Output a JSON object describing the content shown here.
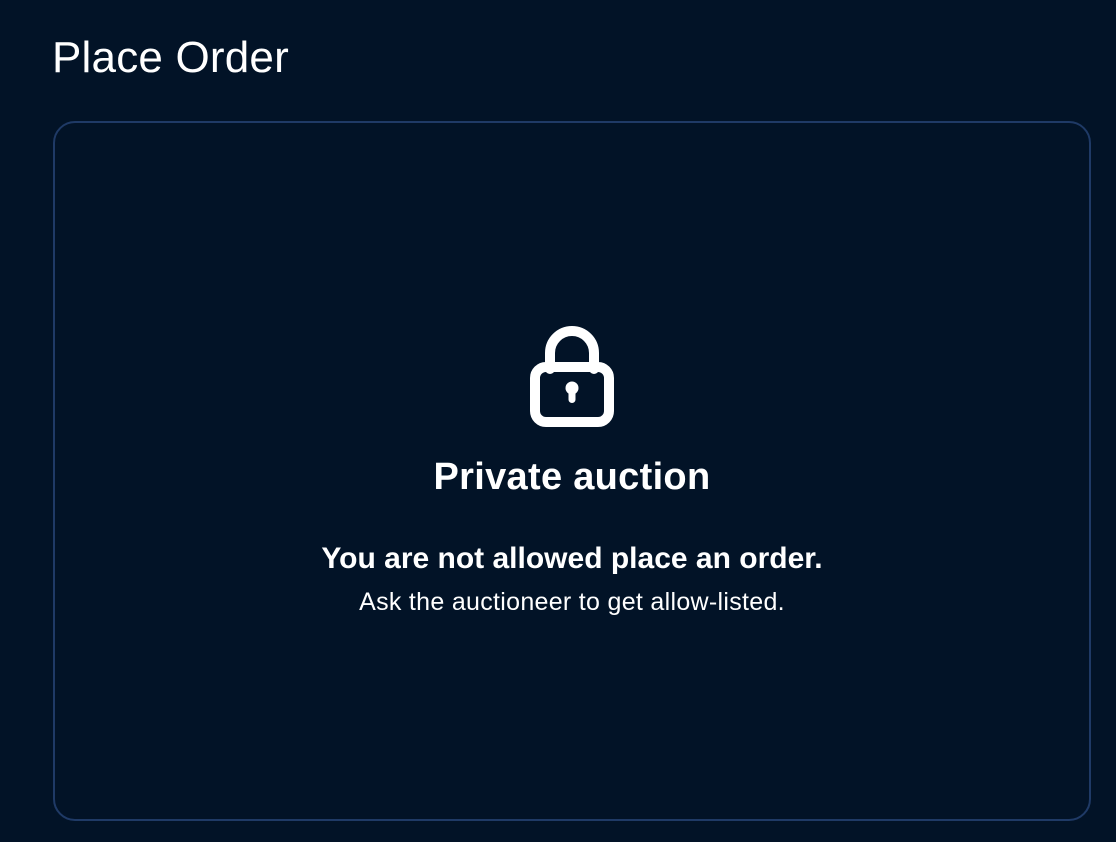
{
  "header": {
    "title": "Place Order"
  },
  "order_panel": {
    "icon": "lock-icon",
    "heading": "Private auction",
    "message": "You are not allowed place an order.",
    "hint": "Ask the auctioneer to get allow-listed."
  },
  "colors": {
    "background": "#021327",
    "card_border": "#1f3a66",
    "text": "#ffffff"
  }
}
